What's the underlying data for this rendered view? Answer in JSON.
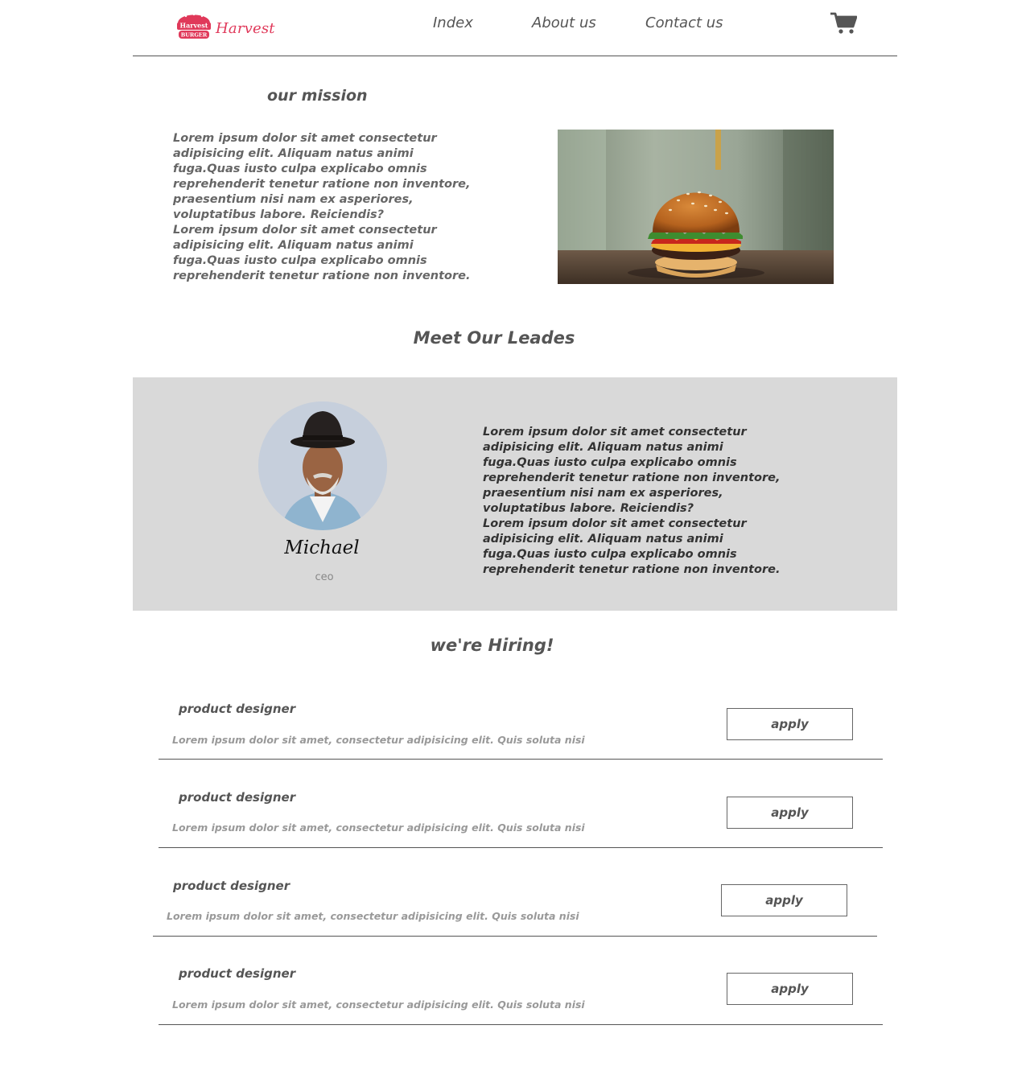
{
  "header": {
    "logo_mark_text_top": "Harvest",
    "logo_mark_text_bottom": "BURGER",
    "logo_text": "Harvest",
    "nav": {
      "index": "Index",
      "about": "About us",
      "contact": "Contact us"
    },
    "cart_icon": "cart-icon",
    "brand_color": "#e0395a"
  },
  "mission": {
    "title": "our mission",
    "text": "Lorem ipsum dolor sit amet consectetur adipisicing elit. Aliquam natus animi fuga.Quas iusto culpa explicabo omnis reprehenderit tenetur ratione non inventore,\n praesentium nisi nam ex asperiores, voluptatibus labore. Reiciendis?\nLorem ipsum dolor sit amet consectetur adipisicing elit. Aliquam natus animi fuga.Quas iusto culpa explicabo omnis reprehenderit tenetur ratione non inventore.",
    "image": "burger-photo"
  },
  "leaders": {
    "title": "Meet Our Leades",
    "name": "Michael",
    "role": "ceo",
    "bio": "Lorem ipsum dolor sit amet consectetur adipisicing elit. Aliquam natus animi fuga.Quas iusto culpa explicabo omnis reprehenderit tenetur ratione non inventore,\n praesentium nisi nam ex asperiores, voluptatibus labore. Reiciendis?\nLorem ipsum dolor sit amet consectetur adipisicing elit. Aliquam natus animi fuga.Quas iusto culpa explicabo omnis reprehenderit tenetur ratione non inventore.",
    "band_color": "#d9d9d9"
  },
  "hiring": {
    "title": "we're Hiring!",
    "jobs": [
      {
        "title": "product designer",
        "desc": "Lorem ipsum dolor sit amet, consectetur adipisicing elit. Quis soluta nisi",
        "button": "apply"
      },
      {
        "title": "product designer",
        "desc": "Lorem ipsum dolor sit amet, consectetur adipisicing elit. Quis soluta nisi",
        "button": "apply"
      },
      {
        "title": "product designer",
        "desc": "Lorem ipsum dolor sit amet, consectetur adipisicing elit. Quis soluta nisi",
        "button": "apply"
      },
      {
        "title": "product designer",
        "desc": "Lorem ipsum dolor sit amet, consectetur adipisicing elit. Quis soluta nisi",
        "button": "apply"
      }
    ]
  }
}
